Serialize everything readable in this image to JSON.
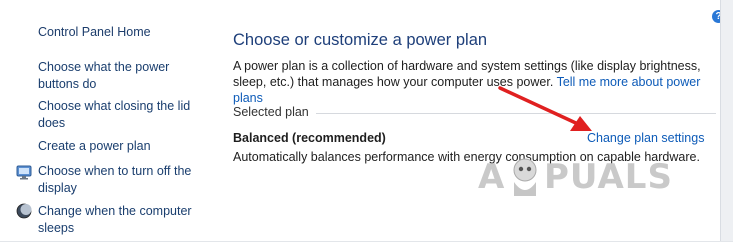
{
  "sidebar": {
    "home": "Control Panel Home",
    "items": [
      {
        "line1": "Choose what the power",
        "line2": "buttons do",
        "icon": null
      },
      {
        "line1": "Choose what closing the lid",
        "line2": "does",
        "icon": null
      },
      {
        "line1": "Create a power plan",
        "line2": "",
        "icon": null
      },
      {
        "line1": "Choose when to turn off the",
        "line2": "display",
        "icon": "monitor-icon"
      },
      {
        "line1": "Change when the computer",
        "line2": "sleeps",
        "icon": "moon-icon"
      }
    ]
  },
  "main": {
    "title": "Choose or customize a power plan",
    "description": "A power plan is a collection of hardware and system settings (like display brightness, sleep, etc.) that manages how your computer uses power.",
    "tell_me_link": "Tell me more about power plans",
    "selected_plan_label": "Selected plan",
    "plan_name": "Balanced (recommended)",
    "change_link": "Change plan settings",
    "plan_description": "Automatically balances performance with energy consumption on capable hardware."
  },
  "help": "?",
  "watermark": {
    "left": "A",
    "right": "PUALS"
  },
  "colors": {
    "link": "#0d5bb8",
    "title": "#1e3f7a",
    "arrow": "#e02020",
    "help": "#2a78d6"
  }
}
